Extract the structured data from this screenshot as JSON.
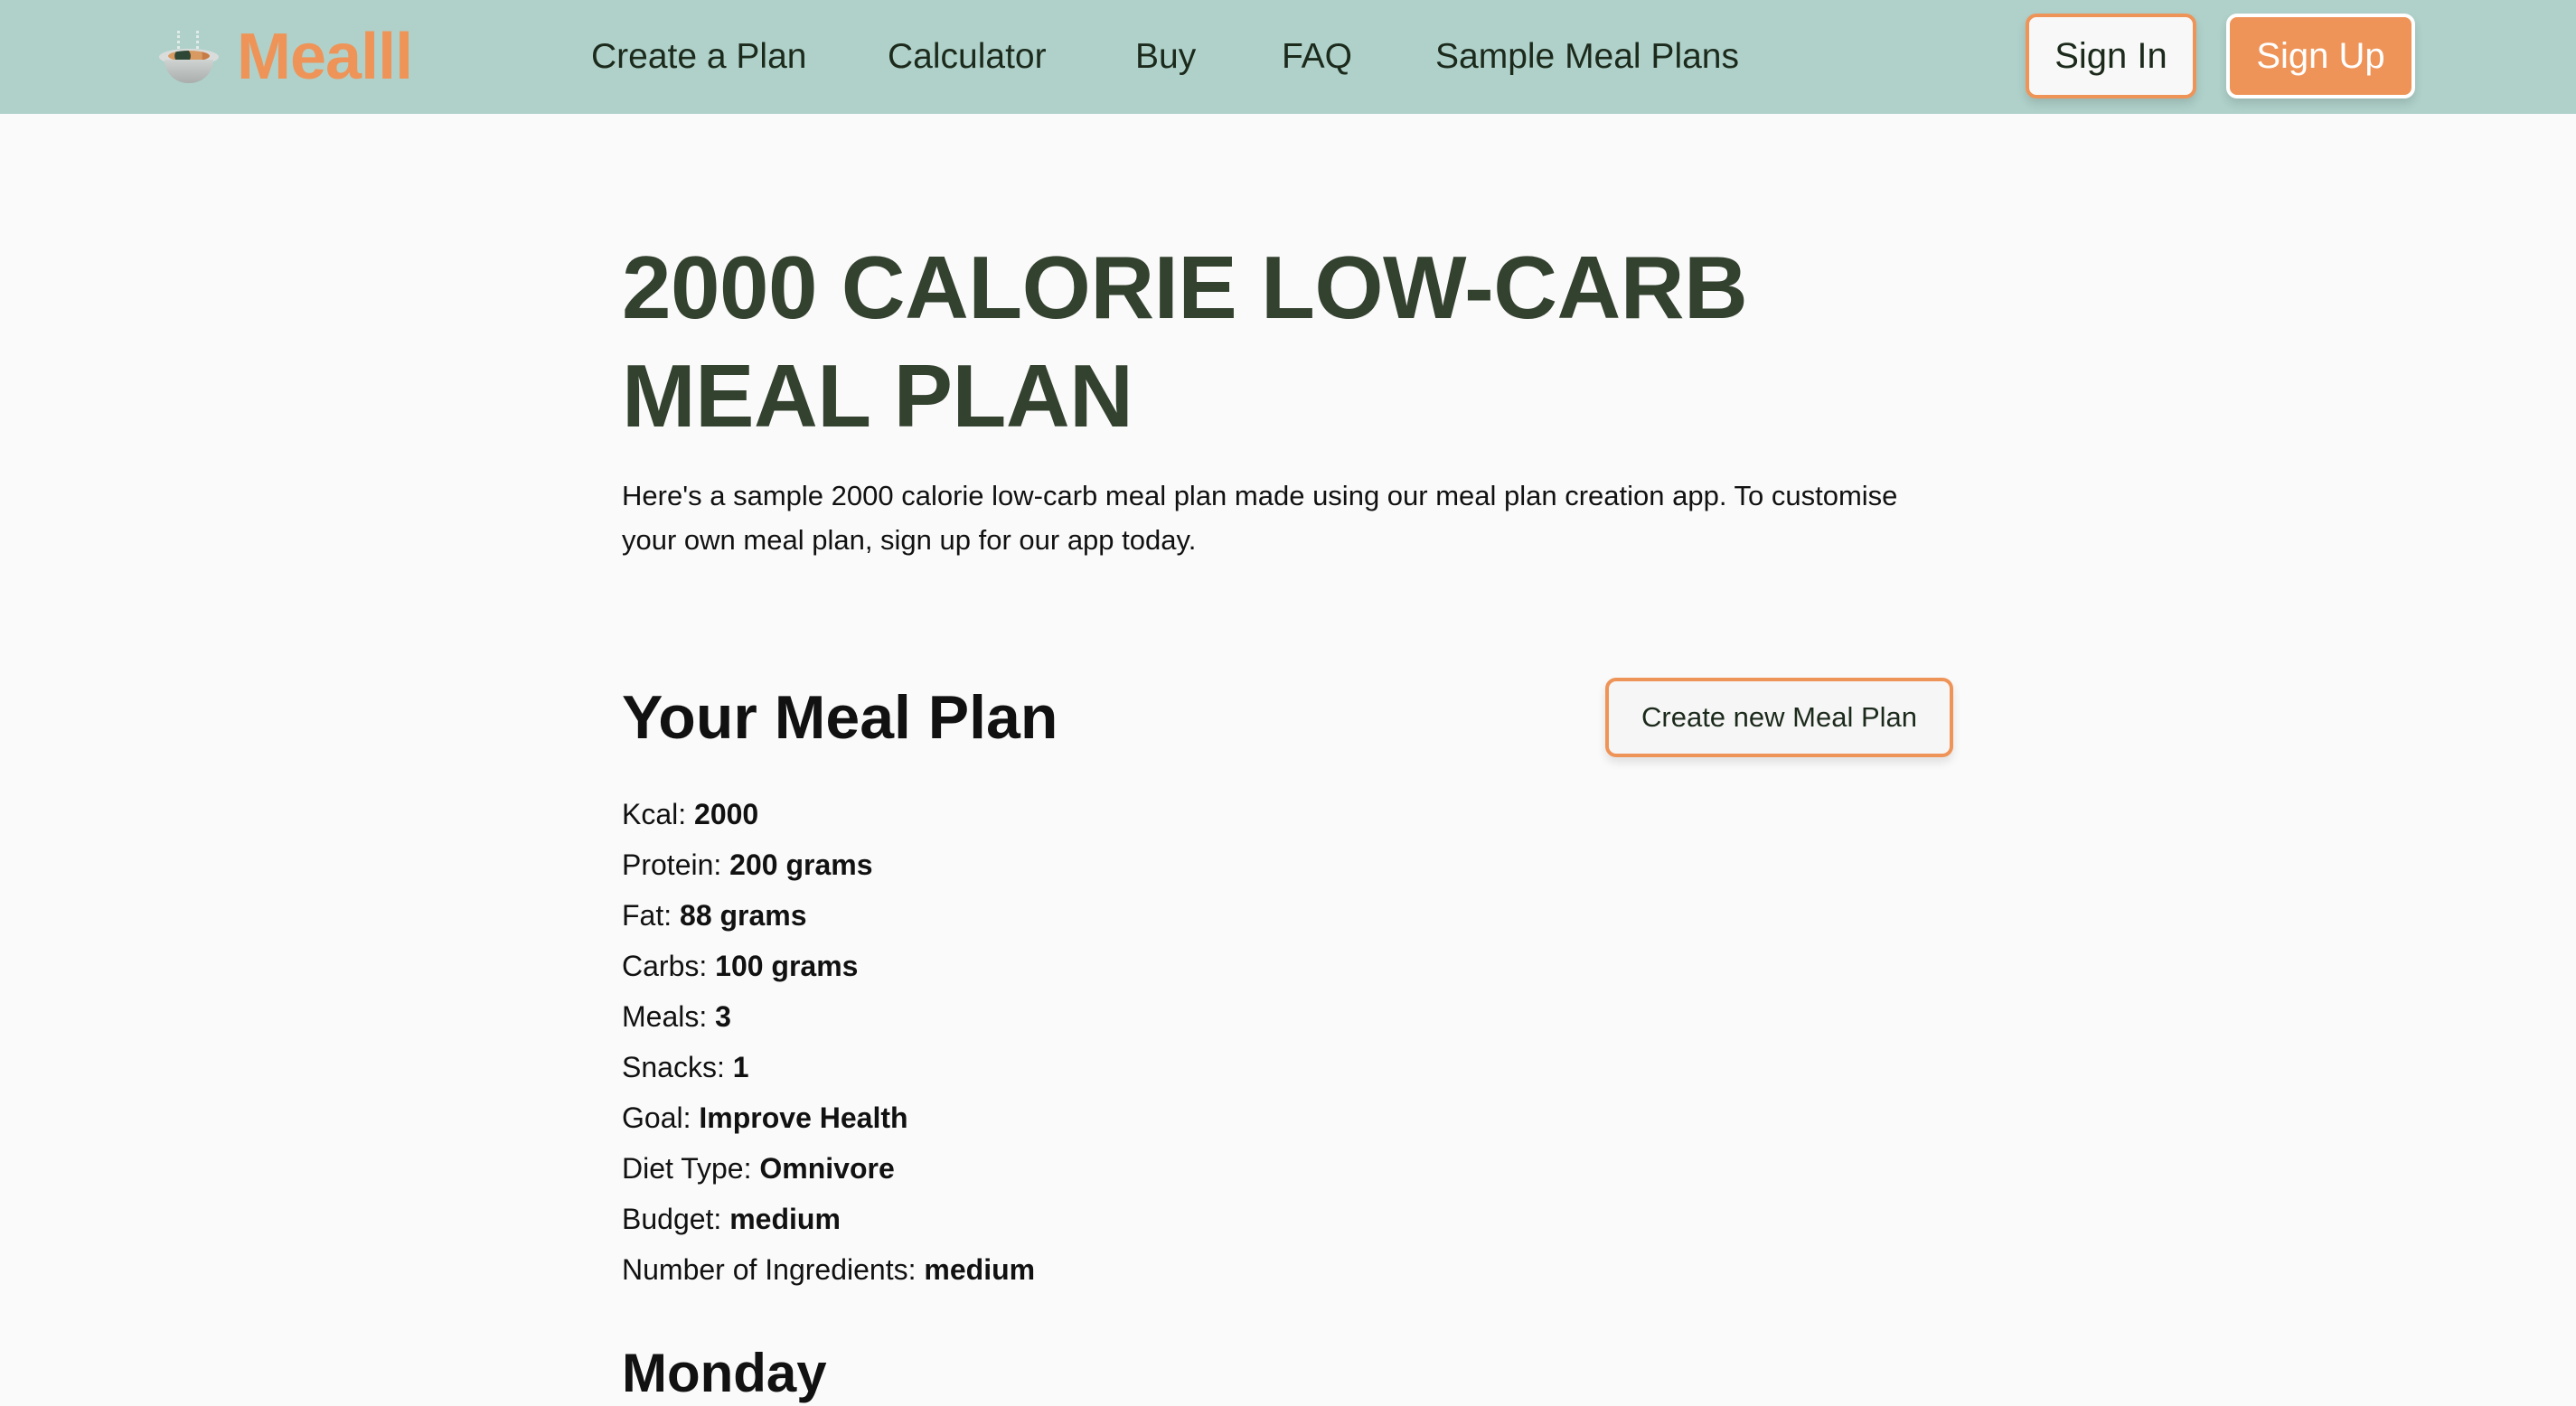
{
  "header": {
    "brand": "Mealll",
    "logo_icon": "soup-bowl-icon",
    "nav": [
      {
        "label": "Create a Plan"
      },
      {
        "label": "Calculator"
      },
      {
        "label": "Buy"
      },
      {
        "label": "FAQ"
      },
      {
        "label": "Sample Meal Plans"
      }
    ],
    "sign_in_label": "Sign In",
    "sign_up_label": "Sign Up"
  },
  "colors": {
    "header_bg": "#afd1ca",
    "accent": "#ef9458",
    "title_text": "#33412f",
    "page_bg": "#fafafa"
  },
  "main": {
    "title": "2000 CALORIE LOW-CARB MEAL PLAN",
    "intro": "Here's a sample 2000 calorie low-carb meal plan made using our meal plan creation app. To customise your own meal plan, sign up for our app today.",
    "section_title": "Your Meal Plan",
    "create_button_label": "Create new Meal Plan",
    "stats": [
      {
        "label": "Kcal:",
        "value": "2000"
      },
      {
        "label": "Protein:",
        "value": "200 grams"
      },
      {
        "label": "Fat:",
        "value": "88 grams"
      },
      {
        "label": "Carbs:",
        "value": "100 grams"
      },
      {
        "label": "Meals:",
        "value": "3"
      },
      {
        "label": "Snacks:",
        "value": "1"
      },
      {
        "label": "Goal:",
        "value": "Improve Health"
      },
      {
        "label": "Diet Type:",
        "value": "Omnivore"
      },
      {
        "label": "Budget:",
        "value": "medium"
      },
      {
        "label": "Number of Ingredients:",
        "value": "medium"
      }
    ],
    "day_title": "Monday"
  }
}
